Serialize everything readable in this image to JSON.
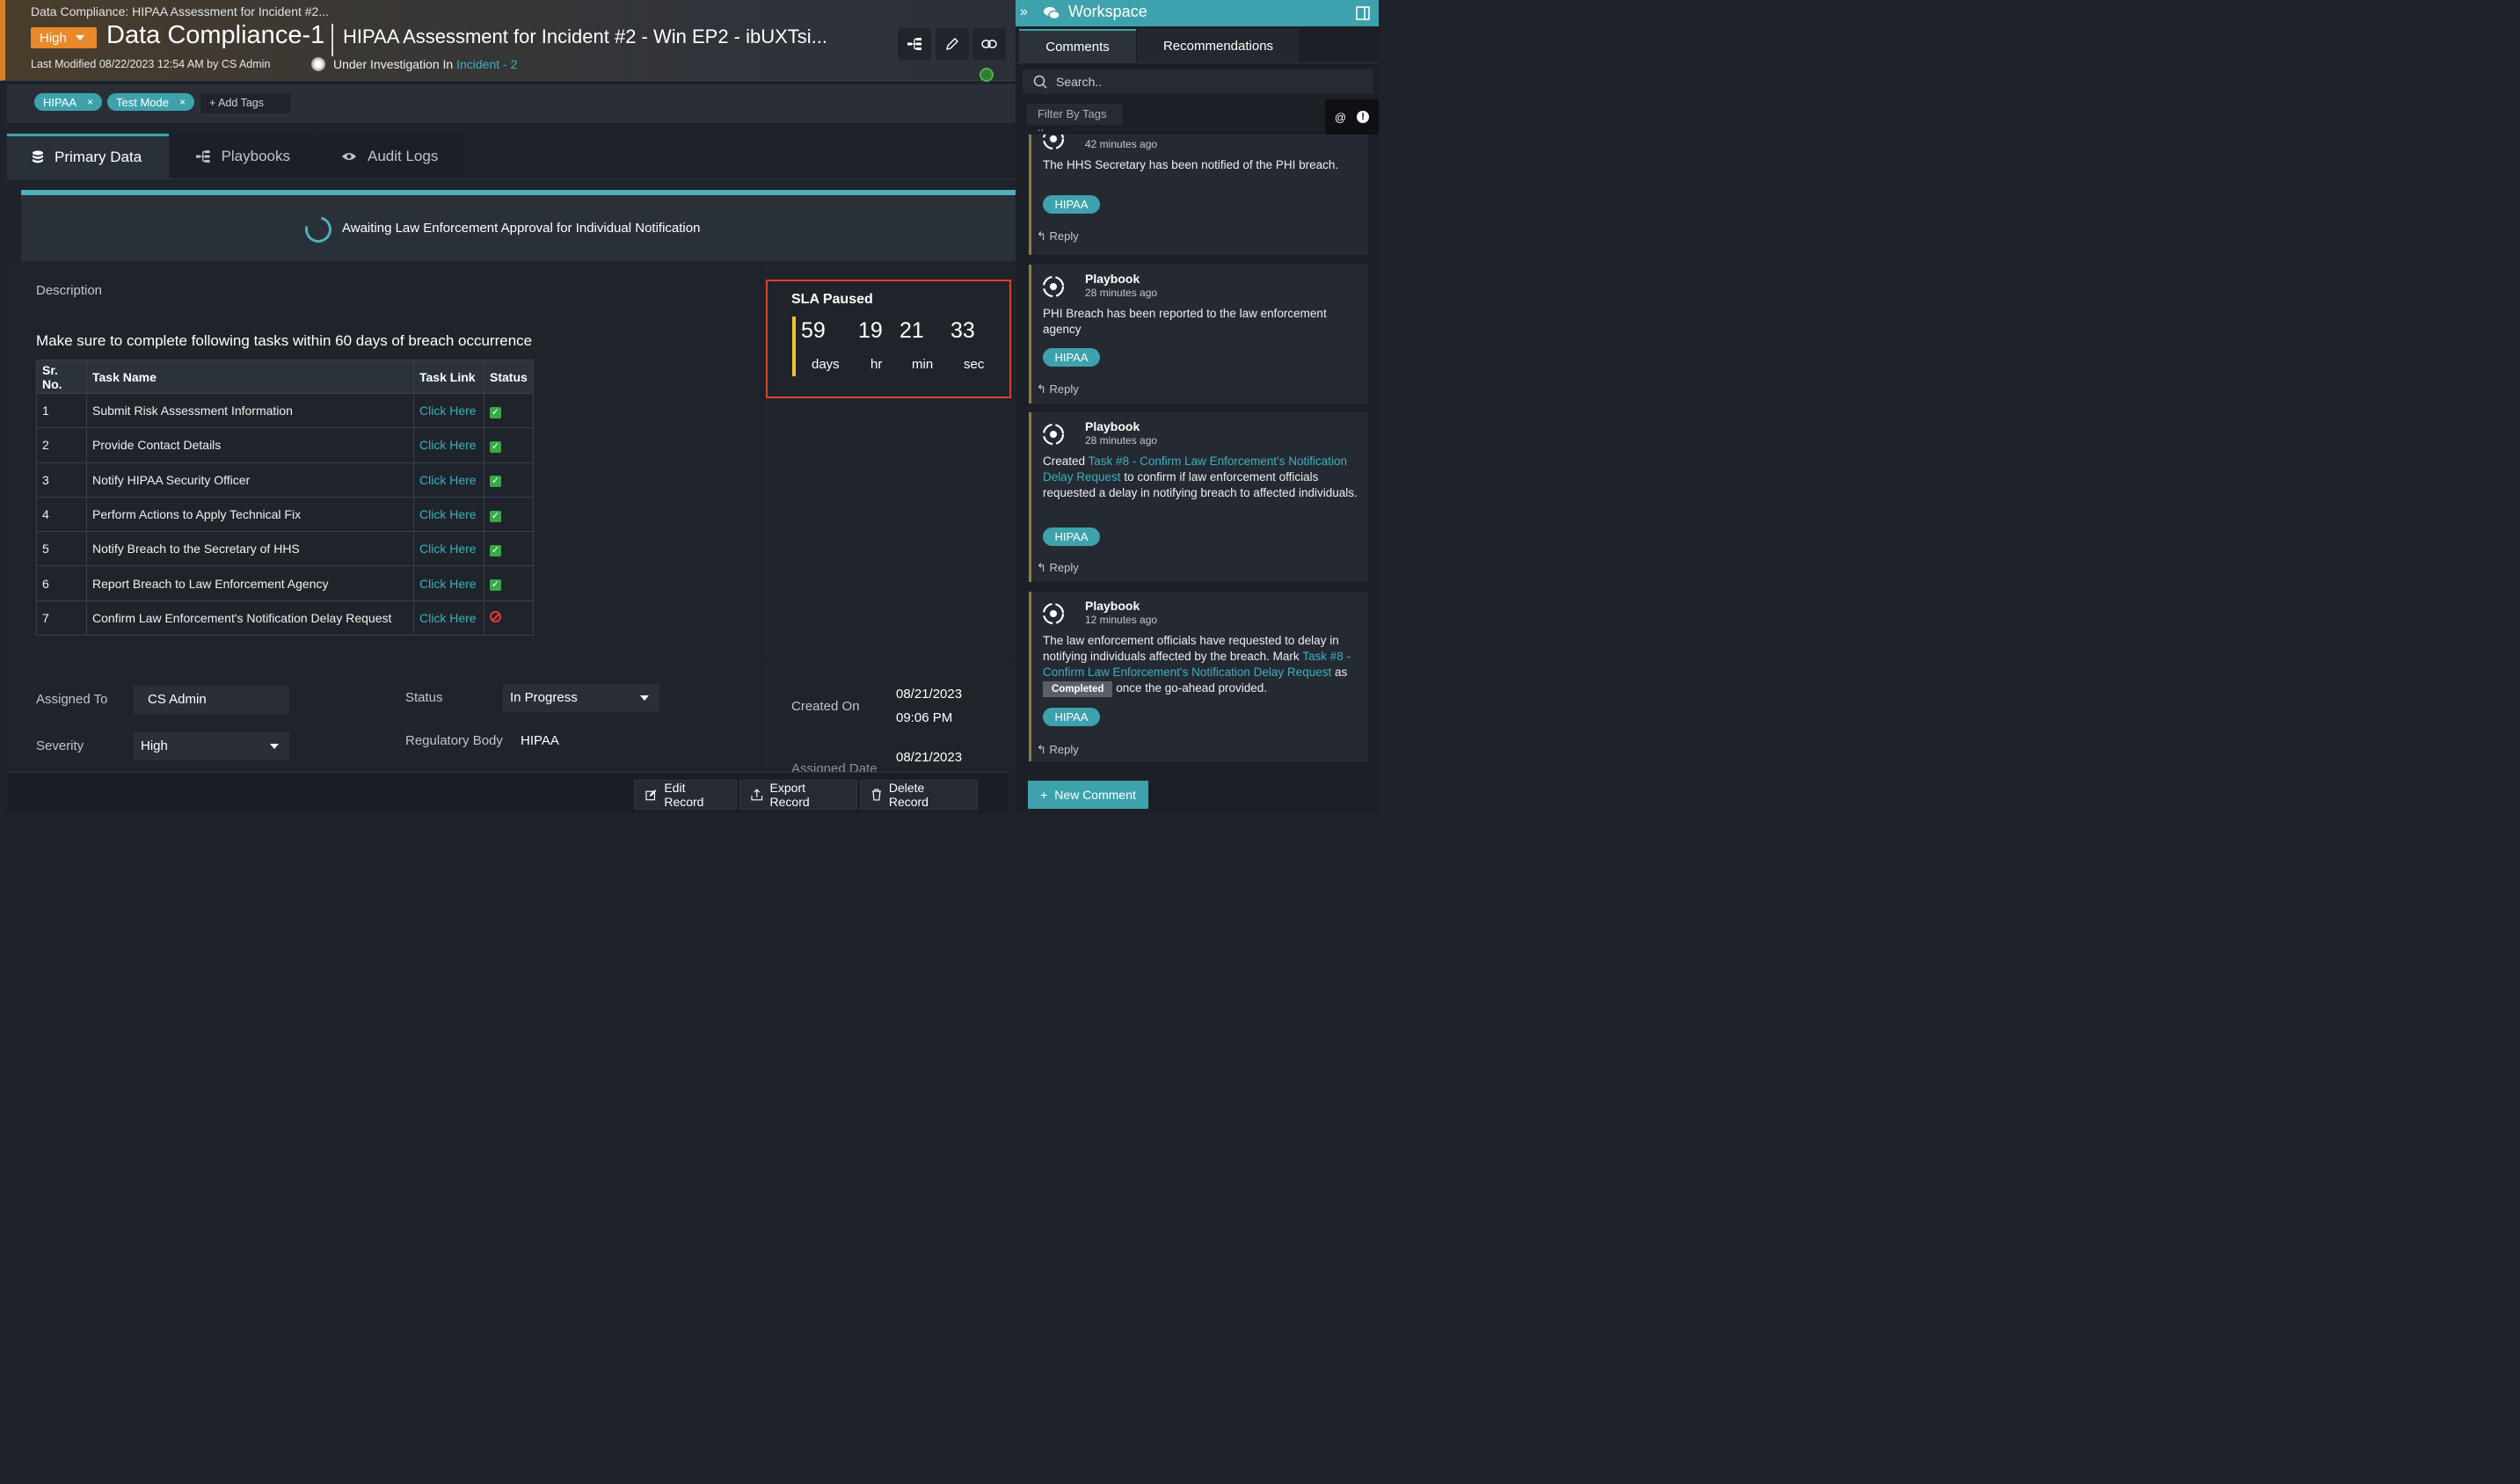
{
  "header": {
    "breadcrumb": "Data Compliance: HIPAA Assessment for Incident #2...",
    "priority": "High",
    "record_name": "Data Compliance-1",
    "record_title": "HIPAA Assessment for Incident #2 - Win EP2 - ibUXTsi...",
    "last_modified": "Last Modified 08/22/2023 12:54 AM by CS Admin",
    "status_prefix": "Under Investigation In",
    "status_link": "Incident - 2"
  },
  "tags": {
    "items": [
      "HIPAA",
      "Test Mode"
    ],
    "add_label": "+ Add Tags"
  },
  "tabs": [
    "Primary Data",
    "Playbooks",
    "Audit Logs"
  ],
  "banner": {
    "text": "Awaiting Law Enforcement Approval for Individual Notification"
  },
  "description": {
    "label": "Description",
    "heading": "Make sure to complete following tasks within 60 days of breach occurrence",
    "columns": [
      "Sr. No.",
      "Task Name",
      "Task Link",
      "Status"
    ],
    "rows": [
      {
        "no": "1",
        "name": "Submit Risk Assessment Information",
        "link": "Click Here",
        "status": "done"
      },
      {
        "no": "2",
        "name": "Provide Contact Details",
        "link": "Click Here",
        "status": "done"
      },
      {
        "no": "3",
        "name": "Notify HIPAA Security Officer",
        "link": "Click Here",
        "status": "done"
      },
      {
        "no": "4",
        "name": "Perform Actions to Apply Technical Fix",
        "link": "Click Here",
        "status": "done"
      },
      {
        "no": "5",
        "name": "Notify Breach to the Secretary of HHS",
        "link": "Click Here",
        "status": "done"
      },
      {
        "no": "6",
        "name": "Report Breach to Law Enforcement Agency",
        "link": "Click Here",
        "status": "done"
      },
      {
        "no": "7",
        "name": "Confirm Law Enforcement's Notification Delay Request",
        "link": "Click Here",
        "status": "blocked"
      }
    ]
  },
  "sla": {
    "title": "SLA Paused",
    "days": "59",
    "hr": "19",
    "min": "21",
    "sec": "33",
    "days_label": "days",
    "hr_label": "hr",
    "min_label": "min",
    "sec_label": "sec"
  },
  "fields": {
    "assigned_to_label": "Assigned To",
    "assigned_to": "CS Admin",
    "severity_label": "Severity",
    "severity": "High",
    "status_label": "Status",
    "status": "In Progress",
    "regulatory_label": "Regulatory Body",
    "regulatory": "HIPAA",
    "created_on_label": "Created On",
    "created_on_date": "08/21/2023",
    "created_on_time": "09:06 PM",
    "assigned_date_label": "Assigned Date",
    "assigned_date": "08/21/2023"
  },
  "footer": {
    "edit": "Edit Record",
    "export": "Export Record",
    "delete": "Delete Record"
  },
  "workspace": {
    "title": "Workspace",
    "tab_comments": "Comments",
    "tab_recommendations": "Recommendations",
    "search_placeholder": "Search..",
    "filter_placeholder": "Filter By Tags ..",
    "new_comment": "New Comment",
    "reply": "Reply",
    "comments": [
      {
        "who": "",
        "ago": "42 minutes ago",
        "text": "The HHS Secretary has been notified of the PHI breach.",
        "tag": "HIPAA"
      },
      {
        "who": "Playbook",
        "ago": "28 minutes ago",
        "text": "PHI Breach has been reported to the law enforcement agency",
        "tag": "HIPAA"
      },
      {
        "who": "Playbook",
        "ago": "28 minutes ago",
        "text_pre": "Created",
        "text_link": "Task #8 - Confirm Law Enforcement's Notification Delay Request",
        "text_post": "to confirm if law enforcement officials requested a delay in notifying breach to affected individuals.",
        "tag": "HIPAA"
      },
      {
        "who": "Playbook",
        "ago": "12 minutes ago",
        "text_pre": "The law enforcement officials have requested to delay in notifying individuals affected by the breach. Mark",
        "text_link": "Task #8 - Confirm Law Enforcement's Notification Delay Request",
        "text_mid": "as",
        "badge": "Completed",
        "text_post": "once the go-ahead provided.",
        "tag": "HIPAA"
      }
    ]
  },
  "colors": {
    "accent": "#3ea2ad",
    "priority": "#e8892a",
    "sla_border": "#d9422b"
  }
}
